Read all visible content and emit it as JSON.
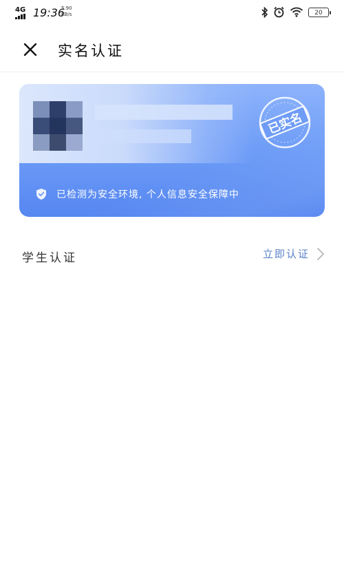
{
  "status_bar": {
    "network": "4G",
    "time": "19:36",
    "speed_value": "5.90",
    "speed_unit": "KB/s",
    "battery": "20"
  },
  "header": {
    "title": "实名认证"
  },
  "card": {
    "stamp_text": "已实名",
    "env_text": "已检测为安全环境, 个人信息安全保障中"
  },
  "student": {
    "label": "学生认证",
    "action": "立即认证"
  },
  "colors": {
    "card_top": "#8db3fb",
    "card_bottom": "#5687f1",
    "link": "#5a80c8"
  },
  "icons": [
    "signal-icon",
    "bluetooth-icon",
    "alarm-icon",
    "wifi-icon",
    "battery-icon",
    "close-icon",
    "verified-stamp-icon",
    "shield-check-icon",
    "chevron-right-icon"
  ]
}
